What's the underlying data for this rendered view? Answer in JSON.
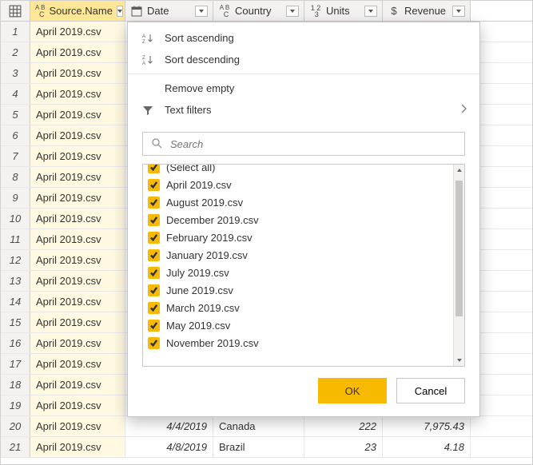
{
  "columns": [
    {
      "name": "Source.Name",
      "type": "text"
    },
    {
      "name": "Date",
      "type": "date"
    },
    {
      "name": "Country",
      "type": "text"
    },
    {
      "name": "Units",
      "type": "number"
    },
    {
      "name": "Revenue",
      "type": "currency"
    }
  ],
  "rows": [
    {
      "n": 1,
      "source": "April 2019.csv"
    },
    {
      "n": 2,
      "source": "April 2019.csv"
    },
    {
      "n": 3,
      "source": "April 2019.csv"
    },
    {
      "n": 4,
      "source": "April 2019.csv"
    },
    {
      "n": 5,
      "source": "April 2019.csv"
    },
    {
      "n": 6,
      "source": "April 2019.csv"
    },
    {
      "n": 7,
      "source": "April 2019.csv"
    },
    {
      "n": 8,
      "source": "April 2019.csv"
    },
    {
      "n": 9,
      "source": "April 2019.csv"
    },
    {
      "n": 10,
      "source": "April 2019.csv"
    },
    {
      "n": 11,
      "source": "April 2019.csv"
    },
    {
      "n": 12,
      "source": "April 2019.csv"
    },
    {
      "n": 13,
      "source": "April 2019.csv"
    },
    {
      "n": 14,
      "source": "April 2019.csv"
    },
    {
      "n": 15,
      "source": "April 2019.csv"
    },
    {
      "n": 16,
      "source": "April 2019.csv"
    },
    {
      "n": 17,
      "source": "April 2019.csv"
    },
    {
      "n": 18,
      "source": "April 2019.csv"
    },
    {
      "n": 19,
      "source": "April 2019.csv"
    },
    {
      "n": 20,
      "source": "April 2019.csv",
      "date": "4/4/2019",
      "country": "Canada",
      "units": "222",
      "revenue": "7,975.43"
    },
    {
      "n": 21,
      "source": "April 2019.csv",
      "date": "4/8/2019",
      "country": "Brazil",
      "units": "23",
      "revenue": "4.18"
    }
  ],
  "filter_menu": {
    "sort_asc": "Sort ascending",
    "sort_desc": "Sort descending",
    "remove_empty": "Remove empty",
    "text_filters": "Text filters",
    "search_placeholder": "Search",
    "select_all": "(Select all)",
    "values": [
      "April 2019.csv",
      "August 2019.csv",
      "December 2019.csv",
      "February 2019.csv",
      "January 2019.csv",
      "July 2019.csv",
      "June 2019.csv",
      "March 2019.csv",
      "May 2019.csv",
      "November 2019.csv"
    ],
    "ok": "OK",
    "cancel": "Cancel"
  }
}
